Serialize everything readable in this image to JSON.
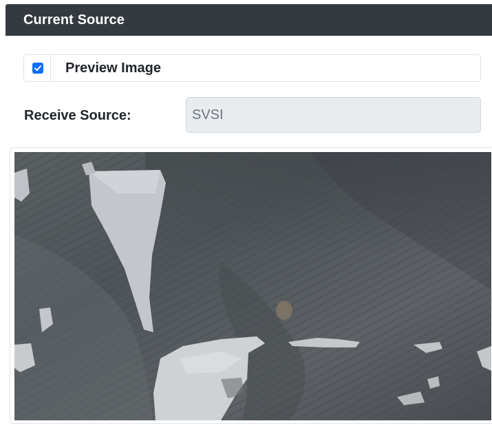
{
  "panel": {
    "title": "Current Source"
  },
  "preview": {
    "label": "Preview Image",
    "checked": true
  },
  "source": {
    "label": "Receive Source:",
    "value": "SVSI"
  },
  "colors": {
    "header_bg": "#343a40",
    "checkbox_accent": "#0d6efd",
    "input_disabled_bg": "#e9ecef"
  },
  "icons": {
    "checkbox": "check-icon"
  }
}
